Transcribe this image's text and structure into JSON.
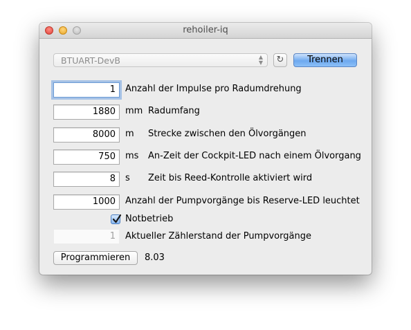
{
  "window": {
    "title": "rehoiler-iq"
  },
  "toolbar": {
    "port_selected": "BTUART-DevB",
    "refresh_icon": "refresh-icon",
    "disconnect_label": "Trennen"
  },
  "settings": [
    {
      "value": "1",
      "unit": "",
      "label": "Anzahl der Impulse pro Radumdrehung"
    },
    {
      "value": "1880",
      "unit": "mm",
      "label": "Radumfang"
    },
    {
      "value": "8000",
      "unit": "m",
      "label": "Strecke zwischen den Ölvorgängen"
    },
    {
      "value": "750",
      "unit": "ms",
      "label": "An-Zeit der Cockpit-LED nach einem Ölvorgang"
    },
    {
      "value": "8",
      "unit": "s",
      "label": "Zeit bis Reed-Kontrolle aktiviert wird"
    },
    {
      "value": "1000",
      "unit": "",
      "label": "Anzahl der Pumpvorgänge bis Reserve-LED leuchtet"
    }
  ],
  "emergency": {
    "label": "Notbetrieb",
    "checked": true
  },
  "counter": {
    "value": "1",
    "label": "Aktueller Zählerstand der Pumpvorgänge"
  },
  "footer": {
    "program_label": "Programmieren",
    "version": "8.03"
  },
  "colors": {
    "accent_button": "#6ea9ef",
    "focus_ring": "#6b9bd6",
    "window_bg": "#ececec"
  }
}
